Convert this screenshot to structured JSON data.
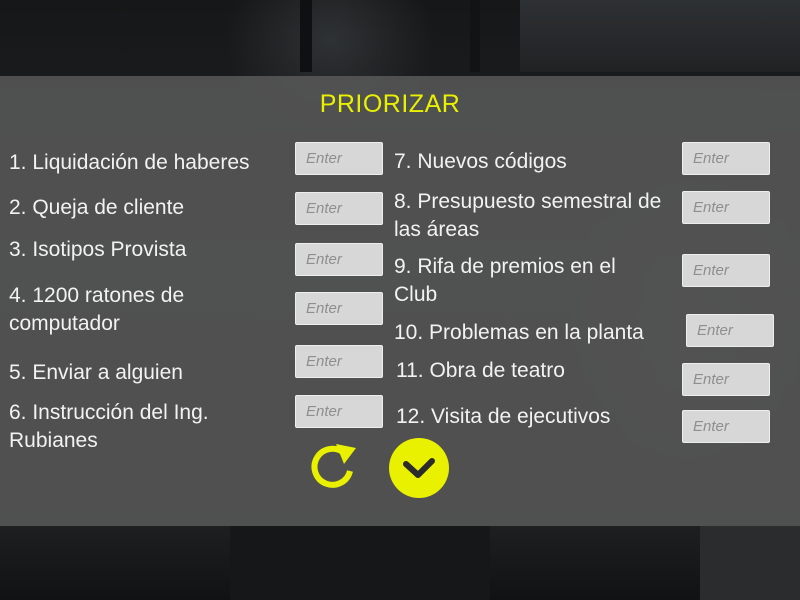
{
  "title": "PRIORIZAR",
  "field_placeholder": "Enter",
  "items": [
    {
      "label": "1. Liquidación de haberes"
    },
    {
      "label": "2. Queja de cliente"
    },
    {
      "label": "3. Isotipos Provista"
    },
    {
      "label": "4. 1200 ratones de computador"
    },
    {
      "label": "5. Enviar a alguien"
    },
    {
      "label": "6. Instrucción del Ing. Rubianes"
    },
    {
      "label": "7.  Nuevos códigos"
    },
    {
      "label": "8. Presupuesto semestral de las áreas"
    },
    {
      "label": "9. Rifa de premios en el Club"
    },
    {
      "label": "10. Problemas en la planta"
    },
    {
      "label": "11. Obra de teatro"
    },
    {
      "label": "12. Visita de ejecutivos"
    }
  ],
  "icons": {
    "reset": "reset-arrow-icon",
    "confirm": "checkmark-icon"
  },
  "colors": {
    "accent": "#e9f000",
    "panel": "#585958",
    "field_bg": "#d7d7d7",
    "text": "#f2f2f2"
  }
}
